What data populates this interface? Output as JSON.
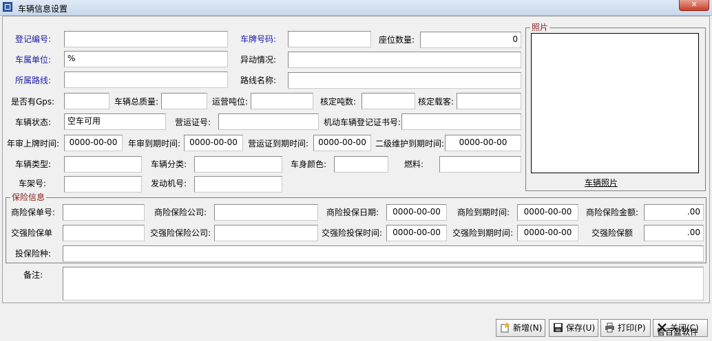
{
  "window": {
    "title": "车辆信息设置",
    "close_label": "✕"
  },
  "vehicle": {
    "reg_no": {
      "label": "登记编号:",
      "value": ""
    },
    "plate_no": {
      "label": "车牌号码:",
      "value": ""
    },
    "seats": {
      "label": "座位数量:",
      "value": "0"
    },
    "unit": {
      "label": "车属单位:",
      "value": "%"
    },
    "change": {
      "label": "异动情况:",
      "value": ""
    },
    "route": {
      "label": "所属路线:",
      "value": ""
    },
    "route_name": {
      "label": "路线名称:",
      "value": ""
    },
    "gps": {
      "label": "是否有Gps:",
      "value": ""
    },
    "total_mass": {
      "label": "车辆总质量:",
      "value": ""
    },
    "transport_tons": {
      "label": "运营吨位:",
      "value": ""
    },
    "rated_tons": {
      "label": "核定吨数:",
      "value": ""
    },
    "rated_passengers": {
      "label": "核定载客:",
      "value": ""
    },
    "status": {
      "label": "车辆状态:",
      "value": "空车可用"
    },
    "permit_no": {
      "label": "营运证号:",
      "value": ""
    },
    "vehicle_reg_cert": {
      "label": "机动车辆登记证书号:",
      "value": ""
    },
    "annual_plate_time": {
      "label": "年审上牌时间:",
      "value": "0000-00-00"
    },
    "annual_expire": {
      "label": "年审到期时间:",
      "value": "0000-00-00"
    },
    "permit_expire": {
      "label": "营运证到期时间:",
      "value": "0000-00-00"
    },
    "maint_expire": {
      "label": "二级维护到期时间:",
      "value": "0000-00-00"
    },
    "type": {
      "label": "车辆类型:",
      "value": ""
    },
    "category": {
      "label": "车辆分类:",
      "value": ""
    },
    "color": {
      "label": "车身颜色:",
      "value": ""
    },
    "fuel": {
      "label": "燃料:",
      "value": ""
    },
    "frame_no": {
      "label": "车架号:",
      "value": ""
    },
    "engine_no": {
      "label": "发动机号:",
      "value": ""
    }
  },
  "photo": {
    "group_label": "照片",
    "link_label": "车辆照片"
  },
  "insurance": {
    "group_label": "保险信息",
    "com_policy": {
      "label": "商险保单号:",
      "value": ""
    },
    "com_company": {
      "label": "商险保险公司:",
      "value": ""
    },
    "com_date": {
      "label": "商险投保日期:",
      "value": "0000-00-00"
    },
    "com_expire": {
      "label": "商险到期时间:",
      "value": "0000-00-00"
    },
    "com_amount": {
      "label": "商险保险金额:",
      "value": ".00"
    },
    "cmp_policy": {
      "label": "交强险保单",
      "value": ""
    },
    "cmp_company": {
      "label": "交强险保险公司:",
      "value": ""
    },
    "cmp_date": {
      "label": "交强险投保时间:",
      "value": "0000-00-00"
    },
    "cmp_expire": {
      "label": "交强险到期时间:",
      "value": "0000-00-00"
    },
    "cmp_amount": {
      "label": "交强险保额",
      "value": ".00"
    },
    "kind": {
      "label": "投保险种:",
      "value": ""
    }
  },
  "remarks": {
    "label": "备注:",
    "value": ""
  },
  "buttons": {
    "new": "新增(N)",
    "save": "保存(U)",
    "print": "打印(P)",
    "close": "关闭(C)"
  },
  "watermark": "智百盈软件",
  "colors": {
    "required_label": "#1a1aa8",
    "title_bar": "#c9d8ec"
  }
}
